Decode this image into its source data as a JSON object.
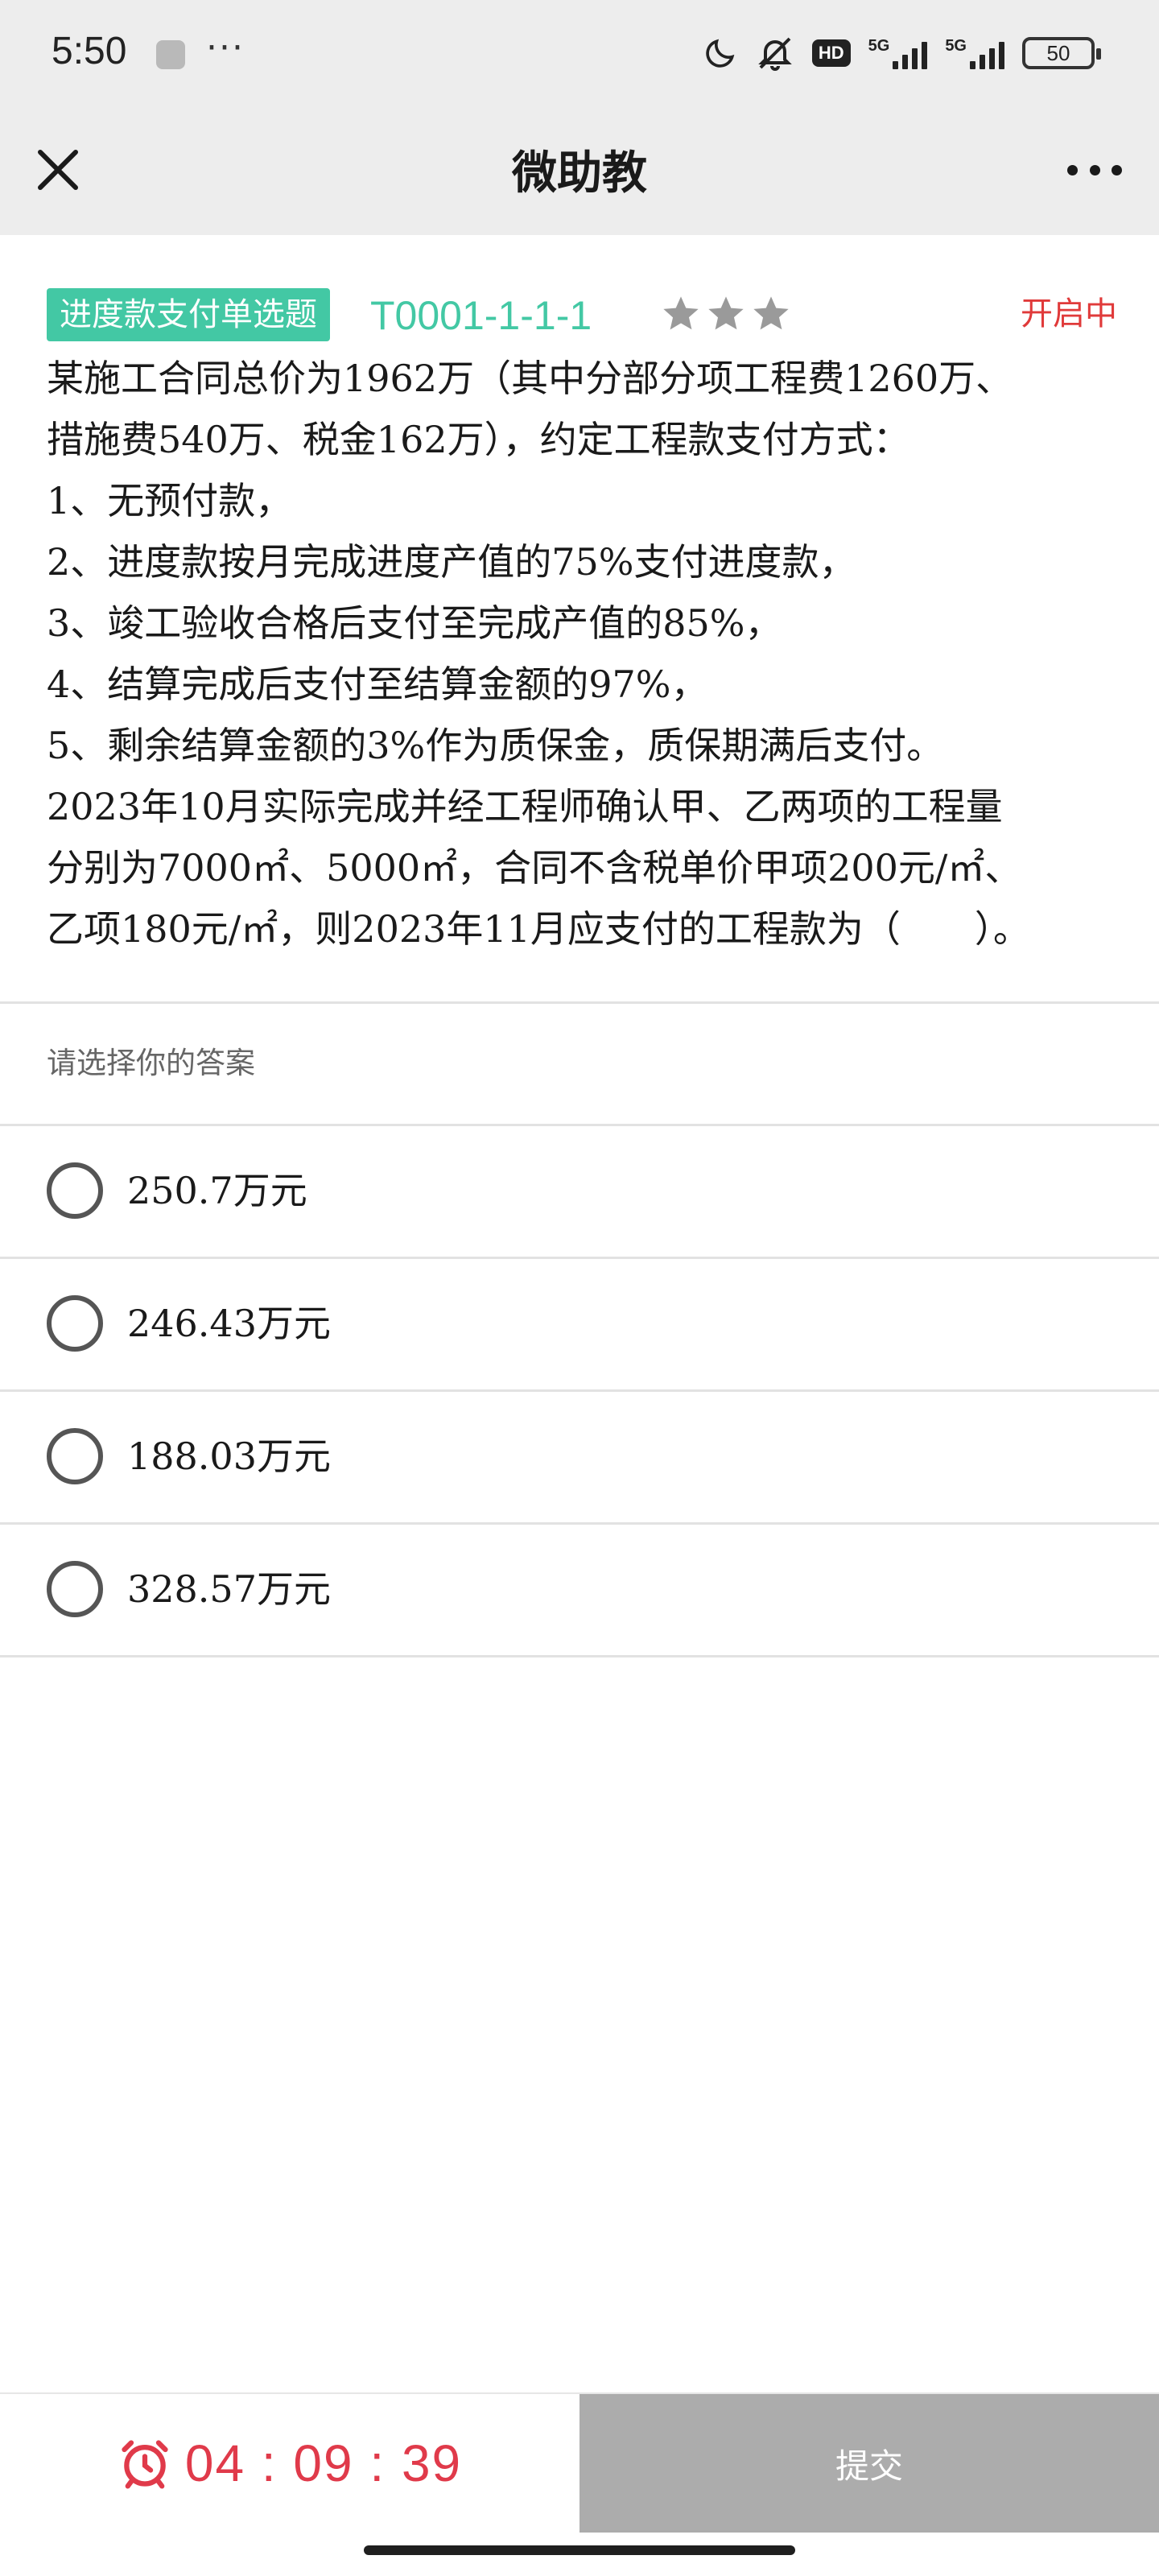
{
  "status_bar": {
    "time": "5:50",
    "more": "···",
    "hd_label": "HD",
    "network_1": "5G",
    "network_2": "5G",
    "battery": "50",
    "icons": [
      "moon-icon",
      "bell-off-icon",
      "signal-icon",
      "battery-icon"
    ]
  },
  "nav": {
    "title": "微助教",
    "close_icon": "close-icon",
    "more_icon": "more-icon"
  },
  "question": {
    "type_label": "进度款支付单选题",
    "code": "T0001-1-1-1",
    "stars": 3,
    "status": "开启中",
    "lines": [
      "某施工合同总价为1962万（其中分部分项工程费1260万、",
      "措施费540万、税金162万），约定工程款支付方式：",
      "1、无预付款，",
      "2、进度款按月完成进度产值的75%支付进度款，",
      "3、竣工验收合格后支付至完成产值的85%，",
      "4、结算完成后支付至结算金额的97%，",
      "5、剩余结算金额的3%作为质保金，质保期满后支付。",
      "2023年10月实际完成并经工程师确认甲、乙两项的工程量",
      "分别为7000㎡、5000㎡，合同不含税单价甲项200元/㎡、",
      "乙项180元/㎡，则2023年11月应支付的工程款为（　　）。"
    ]
  },
  "answer_prompt": "请选择你的答案",
  "options": [
    {
      "label": "250.7万元",
      "selected": false
    },
    {
      "label": "246.43万元",
      "selected": false
    },
    {
      "label": "188.03万元",
      "selected": false
    },
    {
      "label": "328.57万元",
      "selected": false
    }
  ],
  "footer": {
    "timer": "04 : 09 : 39",
    "timer_icon": "alarm-clock-icon",
    "submit_label": "提交"
  },
  "colors": {
    "accent": "#43c8a4",
    "danger": "#e03a3a",
    "submit_bg": "#acacac"
  }
}
